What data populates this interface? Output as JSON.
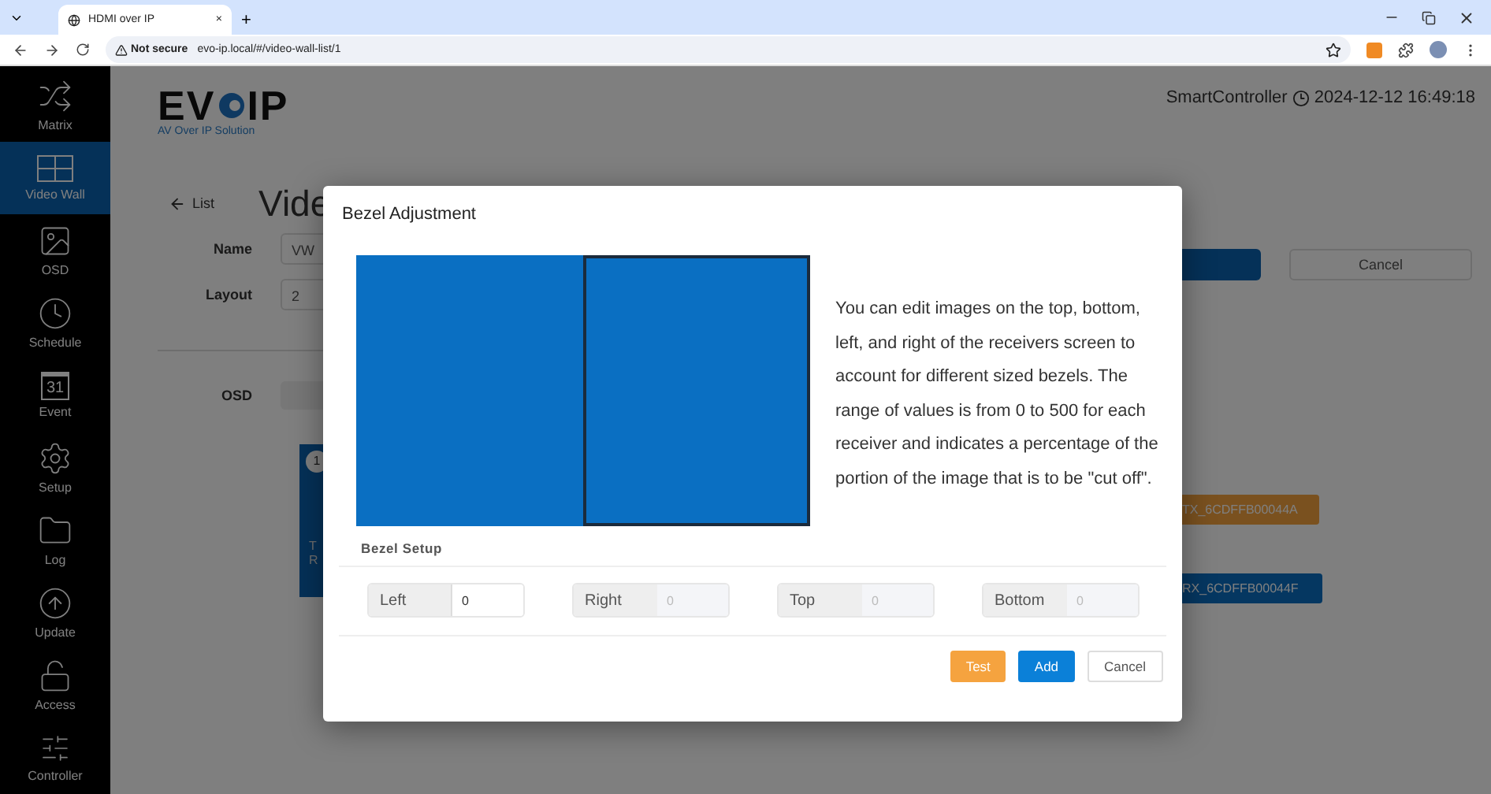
{
  "browser": {
    "tab": {
      "title": "HDMI over IP",
      "close": "×"
    },
    "new_tab": "+",
    "security": "Not secure",
    "url": "evo-ip.local/#/video-wall-list/1"
  },
  "sidebar": {
    "items": [
      {
        "label": "Matrix",
        "selected": false
      },
      {
        "label": "Video Wall",
        "selected": true
      },
      {
        "label": "OSD",
        "selected": false
      },
      {
        "label": "Schedule",
        "selected": false
      },
      {
        "label": "Event",
        "selected": false,
        "icon_text": "31"
      },
      {
        "label": "Setup",
        "selected": false
      },
      {
        "label": "Log",
        "selected": false
      },
      {
        "label": "Update",
        "selected": false
      },
      {
        "label": "Access",
        "selected": false
      },
      {
        "label": "Controller",
        "selected": false
      }
    ]
  },
  "header": {
    "logo": "EV",
    "logo_end": "IP",
    "tagline": "AV Over IP Solution",
    "controller": "SmartController",
    "datetime": "2024-12-12 16:49:18"
  },
  "page": {
    "back": "List",
    "title": "Vide",
    "name_label": "Name",
    "name_value": "VW",
    "layout_label": "Layout",
    "layout_value": "2",
    "osd_label": "OSD",
    "cancel": "Cancel",
    "card": {
      "number": "1",
      "lines": [
        "T",
        "R"
      ]
    },
    "tx_tag": "TX_6CDFFB00044A",
    "rx_tag": "RX_6CDFFB00044F"
  },
  "modal": {
    "title": "Bezel Adjustment",
    "screens": [
      {
        "selected": false
      },
      {
        "selected": true
      }
    ],
    "description": "You can edit images on the top, bottom, left, and right of the receivers screen to account for different sized bezels. The range of values is from 0 to 500 for each receiver and indicates a percentage of the portion of the image that is to be \"cut off\".",
    "section": "Bezel Setup",
    "fields": [
      {
        "label": "Left",
        "value": "0",
        "disabled": false
      },
      {
        "label": "Right",
        "value": "0",
        "disabled": true
      },
      {
        "label": "Top",
        "value": "0",
        "disabled": true
      },
      {
        "label": "Bottom",
        "value": "0",
        "disabled": true
      }
    ],
    "buttons": [
      {
        "label": "Test",
        "kind": "test"
      },
      {
        "label": "Add",
        "kind": "primary"
      },
      {
        "label": "Cancel",
        "kind": "default"
      }
    ]
  }
}
